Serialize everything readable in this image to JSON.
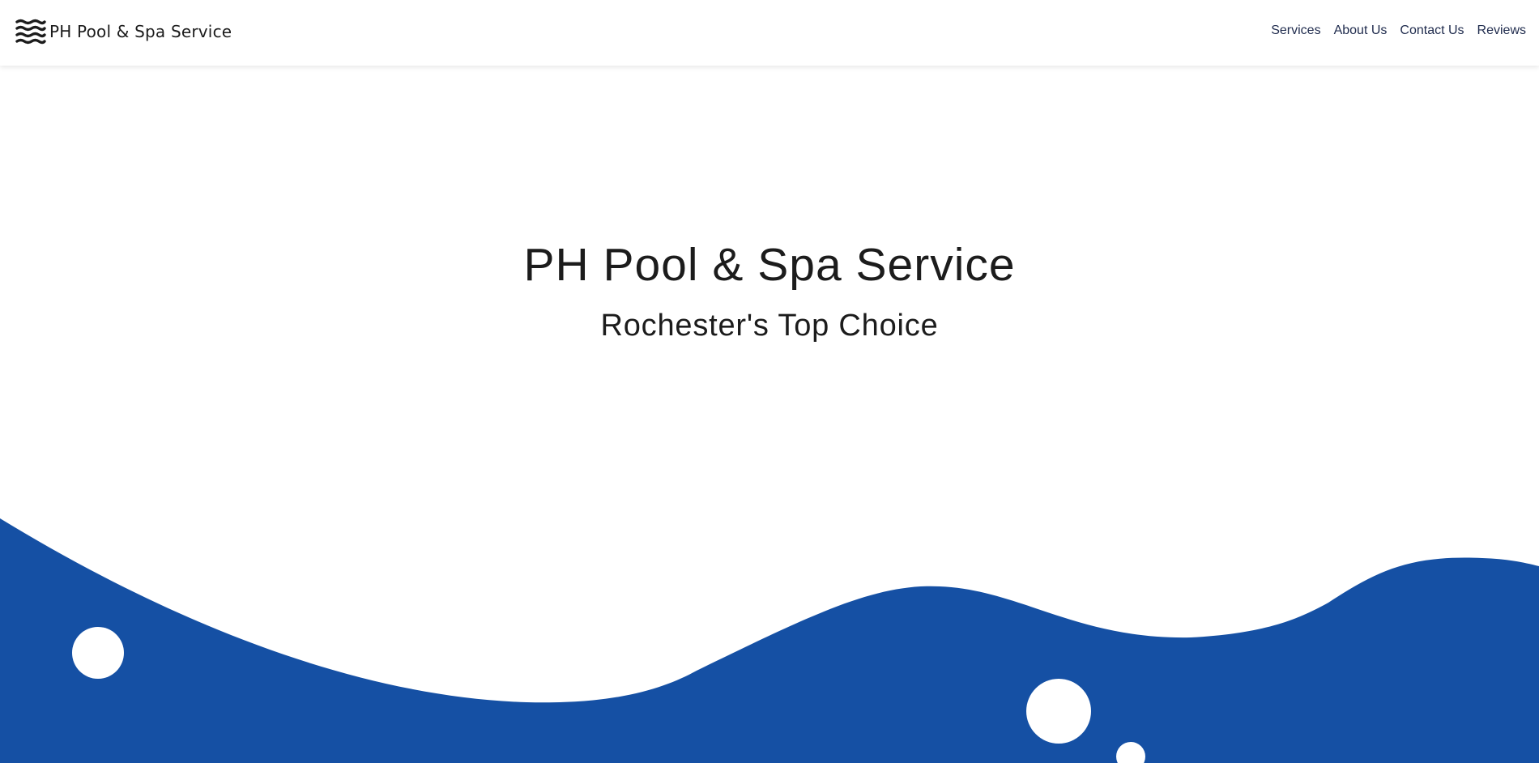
{
  "navbar": {
    "brand_name": "PH Pool & Spa Service",
    "brand_icon": "waves-icon",
    "links": [
      {
        "label": "Services"
      },
      {
        "label": "About Us"
      },
      {
        "label": "Contact Us"
      },
      {
        "label": "Reviews"
      }
    ]
  },
  "hero": {
    "title": "PH Pool & Spa Service",
    "subtitle": "Rochester's Top Choice"
  },
  "colors": {
    "wave": "#1550a4",
    "bubble": "#ffffff",
    "text": "#1c1c1c",
    "nav_link": "#1f2b4d"
  }
}
